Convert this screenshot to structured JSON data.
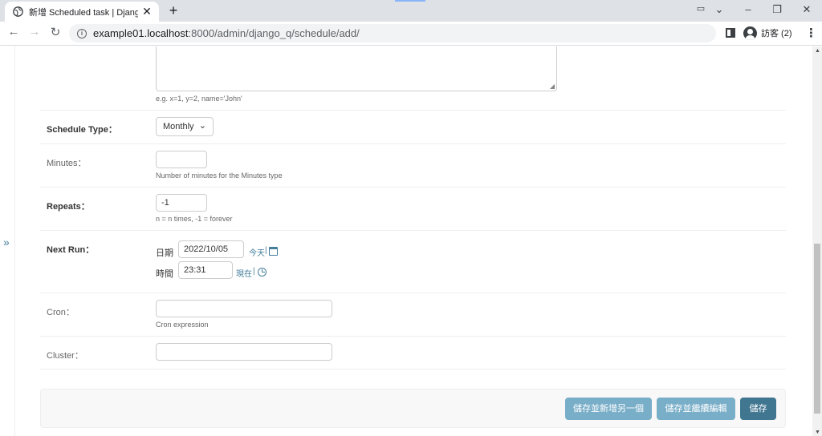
{
  "browser": {
    "tab_title": "新增 Scheduled task | Django 網站",
    "url_host": "example01.localhost",
    "url_path": ":8000/admin/django_q/schedule/add/",
    "profile_label": "訪客 (2)"
  },
  "form": {
    "kwargs_help": "e.g. x=1, y=2, name='John'",
    "schedule_type": {
      "label": "Schedule Type：",
      "value": "Monthly"
    },
    "minutes": {
      "label": "Minutes：",
      "value": "",
      "help": "Number of minutes for the Minutes type"
    },
    "repeats": {
      "label": "Repeats：",
      "value": "-1",
      "help": "n = n times, -1 = forever"
    },
    "next_run": {
      "label": "Next Run：",
      "date_label": "日期",
      "date_value": "2022/10/05",
      "today_link": "今天",
      "time_label": "時間",
      "time_value": "23:31",
      "now_link": "現在",
      "separator": "|"
    },
    "cron": {
      "label": "Cron：",
      "value": "",
      "help": "Cron expression"
    },
    "cluster": {
      "label": "Cluster：",
      "value": ""
    }
  },
  "actions": {
    "save_add_another": "儲存並新增另一個",
    "save_continue": "儲存並繼續編輯",
    "save": "儲存"
  },
  "sidebar_toggle": "»",
  "colors": {
    "primary": "#417690",
    "secondary": "#79aec8",
    "link": "#447e9b"
  }
}
